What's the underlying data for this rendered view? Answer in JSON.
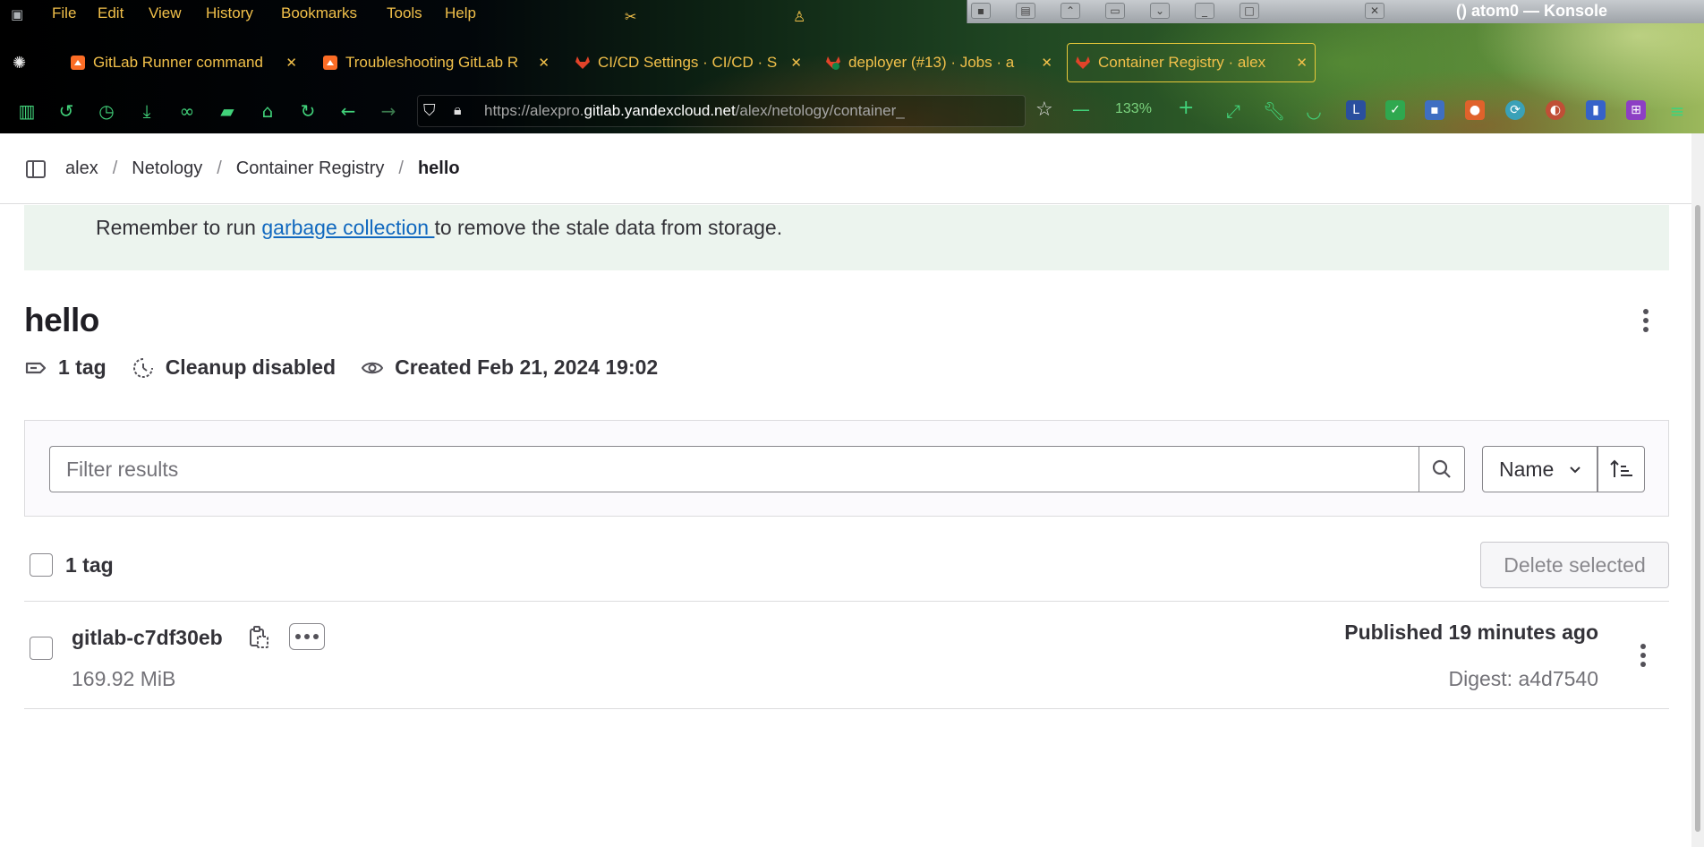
{
  "menubar": {
    "items": [
      "File",
      "Edit",
      "View",
      "History",
      "Bookmarks",
      "Tools",
      "Help"
    ]
  },
  "konsole": {
    "title": "() atom0 — Konsole"
  },
  "tabs": [
    {
      "title": "GitLab Runner command",
      "favicon": "gitlab-icon"
    },
    {
      "title": "Troubleshooting GitLab R",
      "favicon": "gitlab-icon"
    },
    {
      "title": "CI/CD Settings · CI/CD · S",
      "favicon": "gitlab-icon"
    },
    {
      "title": "deployer (#13) · Jobs · a",
      "favicon": "gitlab-success-icon"
    },
    {
      "title": "Container Registry · alex",
      "favicon": "gitlab-icon",
      "active": true
    }
  ],
  "urlbar": {
    "prefix": "https://alexpro.",
    "domain": "gitlab.yandexcloud.net",
    "path": "/alex/netology/container_registry",
    "zoom": "133%"
  },
  "breadcrumbs": {
    "items": [
      "alex",
      "Netology",
      "Container Registry"
    ],
    "current": "hello"
  },
  "alert": {
    "before": "Remember to run ",
    "link": "garbage collection ",
    "after": "to remove the stale data from storage."
  },
  "image": {
    "title": "hello",
    "tags": "1 tag",
    "cleanup": "Cleanup disabled",
    "created": "Created Feb 21, 2024 19:02"
  },
  "filter": {
    "placeholder": "Filter results",
    "sort_label": "Name"
  },
  "list": {
    "count_label": "1 tag",
    "delete_label": "Delete selected",
    "rows": [
      {
        "name": "gitlab-c7df30eb",
        "size": "169.92 MiB",
        "published": "Published 19 minutes ago",
        "digest": "Digest: a4d7540"
      }
    ]
  },
  "colors": {
    "menu_text": "#f1c04a",
    "nav_icon": "#41d27a",
    "link": "#1068bf",
    "alert_bg": "#ecf4ee",
    "gitlab_orange": "#e24329"
  }
}
